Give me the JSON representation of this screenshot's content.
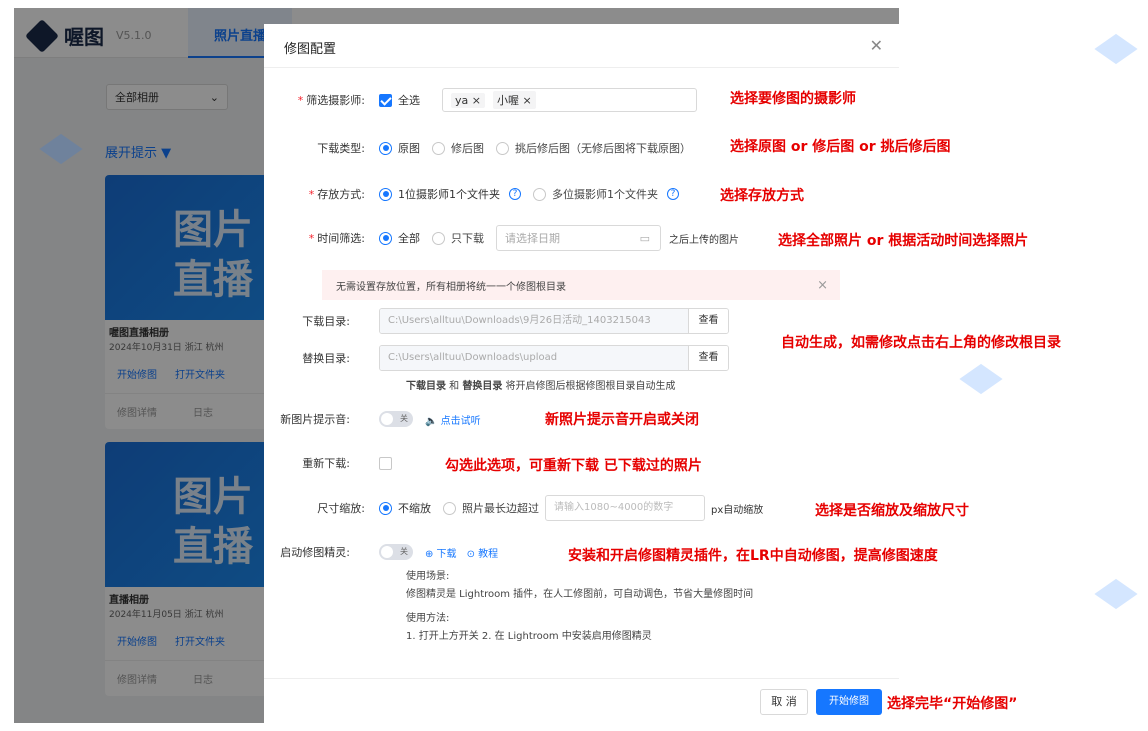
{
  "app": {
    "brand": "喔图",
    "version": "V5.1.0",
    "nav_tab": "照片直播"
  },
  "filters": {
    "album_select": "全部相册"
  },
  "expand_label": "展开提示 ▼",
  "cards": [
    {
      "cover_line1": "图片",
      "cover_line2": "直播",
      "title": "喔图直播相册",
      "date": "2024年10月31日",
      "location": "浙江 杭州",
      "action1": "开始修图",
      "action2": "打开文件夹",
      "action3": "修图详情",
      "action4": "日志"
    },
    {
      "cover_line1": "图片",
      "cover_line2": "直播",
      "title": "直播相册",
      "date": "2024年11月05日",
      "location": "浙江 杭州",
      "action1": "开始修图",
      "action2": "打开文件夹",
      "action3": "修图详情",
      "action4": "日志"
    }
  ],
  "dialog": {
    "title": "修图配置",
    "close": "✕",
    "photographer": {
      "label": "筛选摄影师:",
      "select_all": "全选",
      "tags": [
        "ya ×",
        "小喔 ×"
      ]
    },
    "download_type": {
      "label": "下载类型:",
      "options": [
        "原图",
        "修后图",
        "挑后修后图（无修后图将下载原图）"
      ]
    },
    "storage": {
      "label": "存放方式:",
      "options": [
        "1位摄影师1个文件夹",
        "多位摄影师1个文件夹"
      ]
    },
    "time_filter": {
      "label": "时间筛选:",
      "options": [
        "全部",
        "只下载"
      ],
      "date_placeholder": "请选择日期",
      "suffix": "之后上传的图片"
    },
    "alert": {
      "text": "无需设置存放位置，所有相册将统一一个修图根目录",
      "close": "×"
    },
    "download_dir": {
      "label": "下载目录:",
      "value": "C:\\Users\\alltuu\\Downloads\\9月26日活动_1403215043",
      "button": "查看"
    },
    "replace_dir": {
      "label": "替换目录:",
      "value": "C:\\Users\\alltuu\\Downloads\\upload",
      "button": "查看"
    },
    "dir_note": {
      "b1": "下载目录",
      "and": " 和 ",
      "b2": "替换目录",
      "rest": " 将开启修图后根据修图根目录自动生成"
    },
    "new_photo_sound": {
      "label": "新图片提示音:",
      "switch": "关",
      "link": "🔈 点击试听"
    },
    "redownload": {
      "label": "重新下载:"
    },
    "resize": {
      "label": "尺寸缩放:",
      "options": [
        "不缩放",
        "照片最长边超过"
      ],
      "placeholder": "请输入1080~4000的数字",
      "suffix": "px自动缩放"
    },
    "sprite": {
      "label": "启动修图精灵:",
      "switch": "关",
      "download": "⊕ 下载",
      "tutorial": "⊙ 教程",
      "usage_title": "使用场景:",
      "usage_text": "修图精灵是 Lightroom 插件，在人工修图前，可自动调色，节省大量修图时间",
      "method_title": "使用方法:",
      "method_text": "1. 打开上方开关 2. 在 Lightroom 中安装启用修图精灵"
    },
    "cancel": "取 消",
    "start": "开始修图"
  },
  "annotations": {
    "a1": "选择要修图的摄影师",
    "a2": "选择原图 or 修后图 or 挑后修后图",
    "a3": "选择存放方式",
    "a4": "选择全部照片 or 根据活动时间选择照片",
    "a5": "自动生成，如需修改点击右上角的修改根目录",
    "a6": "新照片提示音开启或关闭",
    "a7": "勾选此选项，可重新下载 已下载过的照片",
    "a8": "选择是否缩放及缩放尺寸",
    "a9": "安装和开启修图精灵插件，在LR中自动修图，提高修图速度",
    "a10": "选择完毕“开始修图”"
  },
  "colors": {
    "primary": "#1677ff",
    "annotation": "#e60000",
    "alert_bg": "#fef0f0"
  }
}
